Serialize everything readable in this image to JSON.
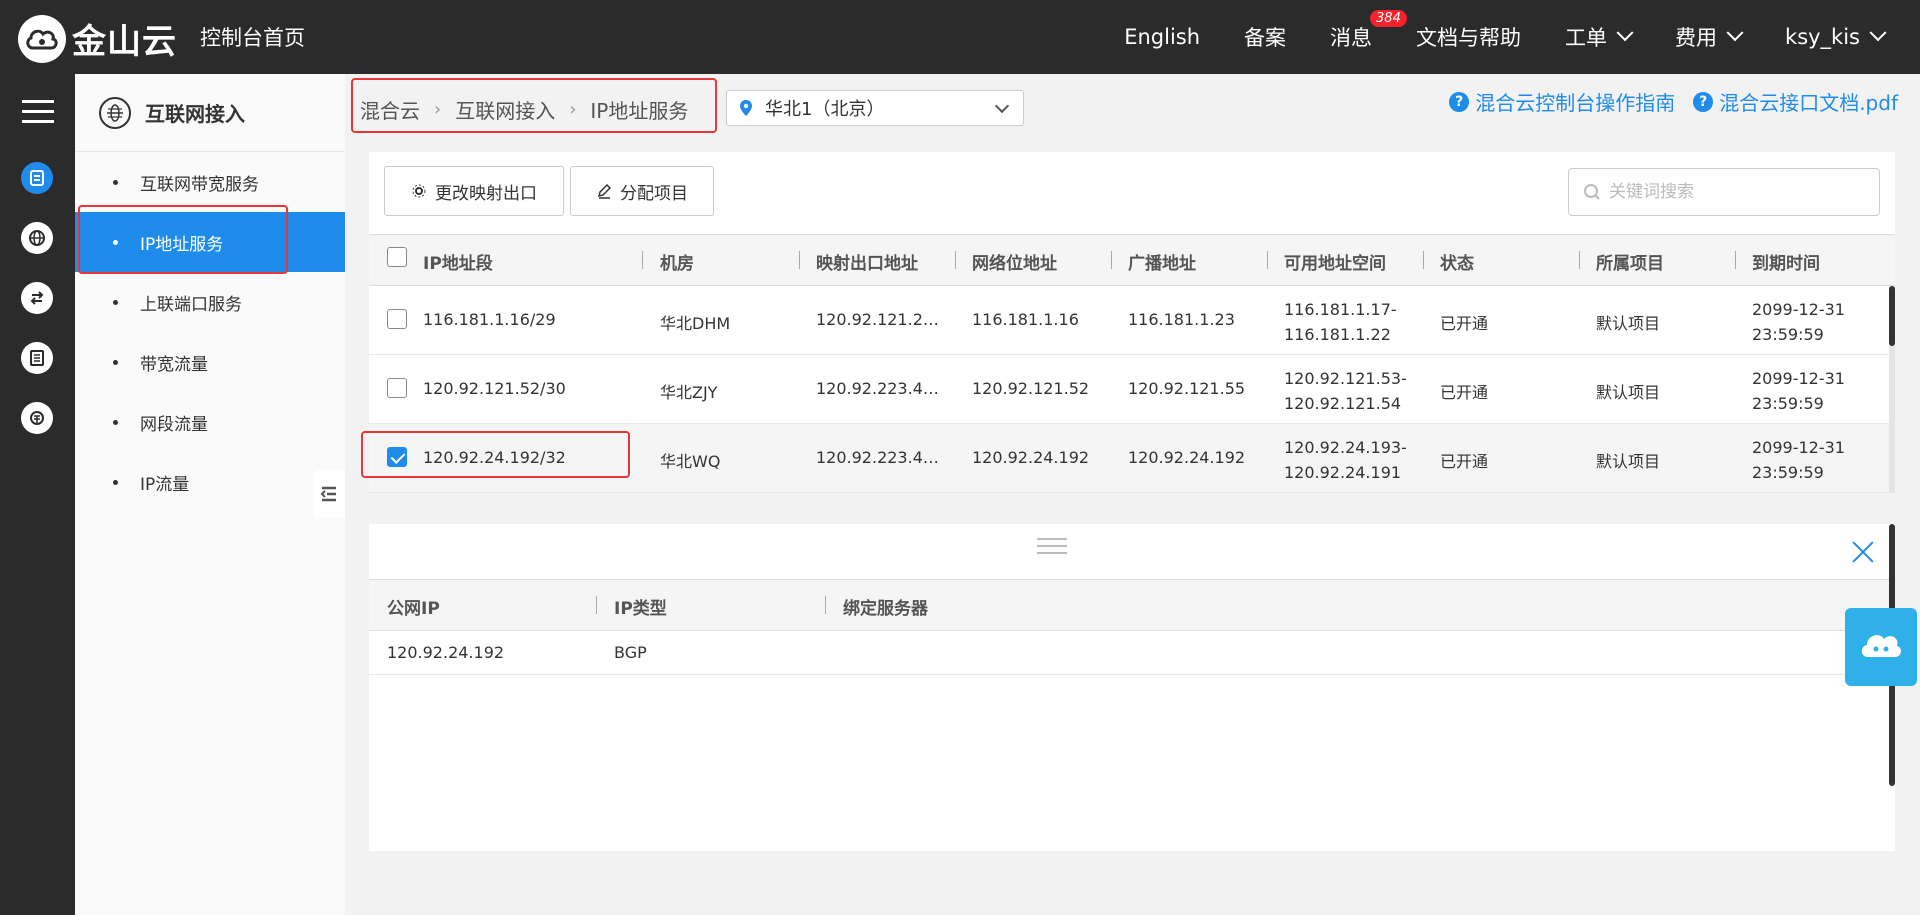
{
  "header": {
    "brand": "金山云",
    "console_home": "控制台首页",
    "nav": [
      {
        "label": "English"
      },
      {
        "label": "备案"
      },
      {
        "label": "消息",
        "badge": "384"
      },
      {
        "label": "文档与帮助"
      },
      {
        "label": "工单",
        "dropdown": true
      },
      {
        "label": "费用",
        "dropdown": true
      },
      {
        "label": "ksy_kis",
        "dropdown": true
      }
    ]
  },
  "sidebar": {
    "title": "互联网接入",
    "items": [
      {
        "label": "互联网带宽服务"
      },
      {
        "label": "IP地址服务",
        "active": true
      },
      {
        "label": "上联端口服务"
      },
      {
        "label": "带宽流量"
      },
      {
        "label": "网段流量"
      },
      {
        "label": "IP流量"
      }
    ]
  },
  "breadcrumb": [
    "混合云",
    "互联网接入",
    "IP地址服务"
  ],
  "region": {
    "selected": "华北1（北京）"
  },
  "doc_links": [
    "混合云控制台操作指南",
    "混合云接口文档.pdf"
  ],
  "toolbar": {
    "change_mapping": "更改映射出口",
    "assign_project": "分配项目",
    "search_placeholder": "关键词搜索"
  },
  "table": {
    "columns": [
      "IP地址段",
      "机房",
      "映射出口地址",
      "网络位地址",
      "广播地址",
      "可用地址空间",
      "状态",
      "所属项目",
      "到期时间"
    ],
    "rows": [
      {
        "checked": false,
        "ip": "116.181.1.16/29",
        "room": "华北DHM",
        "mapping": "120.92.121.2…",
        "network": "116.181.1.16",
        "broadcast": "116.181.1.23",
        "range1": "116.181.1.17-",
        "range2": "116.181.1.22",
        "status": "已开通",
        "project": "默认项目",
        "exp1": "2099-12-31",
        "exp2": "23:59:59"
      },
      {
        "checked": false,
        "ip": "120.92.121.52/30",
        "room": "华北ZJY",
        "mapping": "120.92.223.4…",
        "network": "120.92.121.52",
        "broadcast": "120.92.121.55",
        "range1": "120.92.121.53-",
        "range2": "120.92.121.54",
        "status": "已开通",
        "project": "默认项目",
        "exp1": "2099-12-31",
        "exp2": "23:59:59"
      },
      {
        "checked": true,
        "ip": "120.92.24.192/32",
        "room": "华北WQ",
        "mapping": "120.92.223.4…",
        "network": "120.92.24.192",
        "broadcast": "120.92.24.192",
        "range1": "120.92.24.193-",
        "range2": "120.92.24.191",
        "status": "已开通",
        "project": "默认项目",
        "exp1": "2099-12-31",
        "exp2": "23:59:59"
      }
    ]
  },
  "detail": {
    "columns": [
      "公网IP",
      "IP类型",
      "绑定服务器"
    ],
    "rows": [
      {
        "public_ip": "120.92.24.192",
        "ip_type": "BGP",
        "server": ""
      }
    ]
  },
  "colors": {
    "accent": "#1f8ceb",
    "topbar": "#2b2b2b",
    "highlight": "#e8373a",
    "badge": "#f5222d"
  }
}
